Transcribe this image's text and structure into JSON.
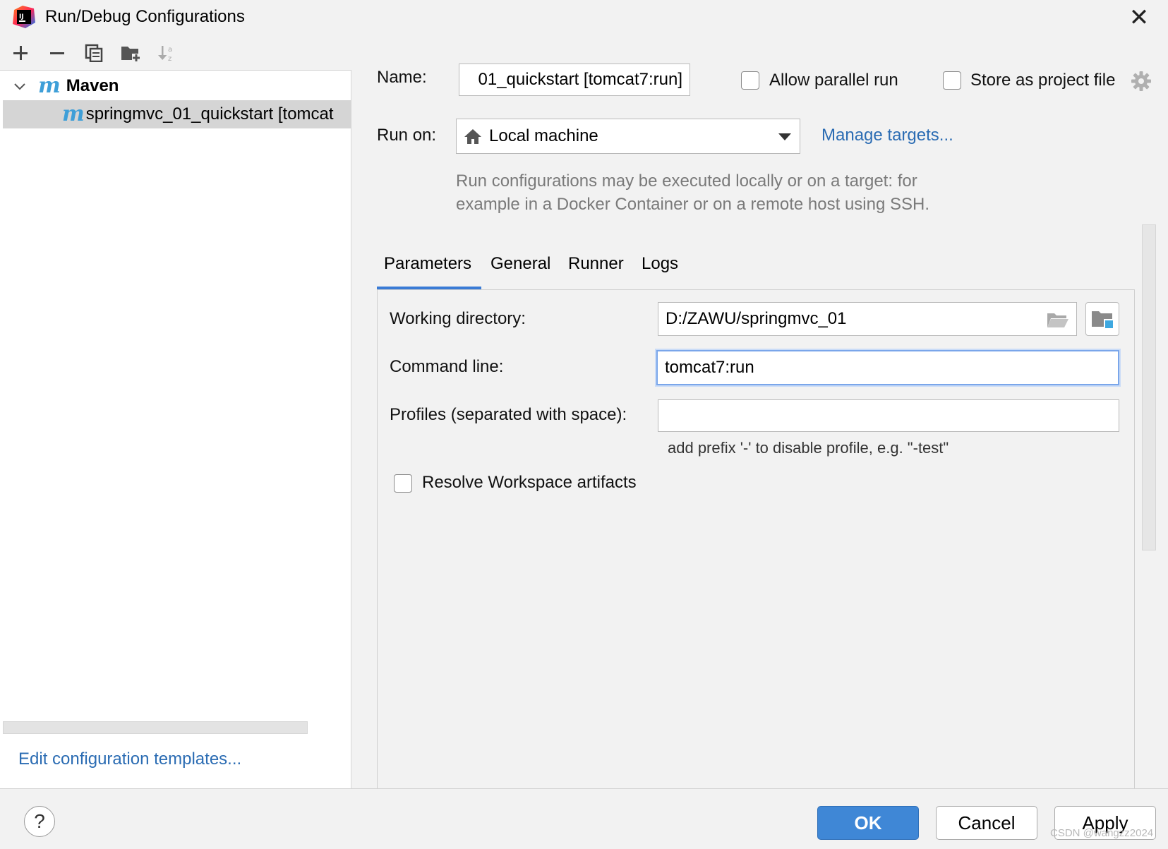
{
  "window": {
    "title": "Run/Debug Configurations",
    "close_label": "✕"
  },
  "sidebar": {
    "tree": {
      "group_label": "Maven",
      "group_icon_letter": "m",
      "item_label": "springmvc_01_quickstart [tomcat",
      "item_icon_letter": "m"
    },
    "edit_templates_link": "Edit configuration templates..."
  },
  "config": {
    "name_label": "Name:",
    "name_value": "01_quickstart [tomcat7:run]",
    "allow_parallel_label": "Allow parallel run",
    "store_project_label": "Store as project file",
    "run_on_label": "Run on:",
    "run_on_value": "Local machine",
    "manage_targets_link": "Manage targets...",
    "hint_line1": "Run configurations may be executed locally or on a target: for",
    "hint_line2": "example in a Docker Container or on a remote host using SSH."
  },
  "tabs": [
    "Parameters",
    "General",
    "Runner",
    "Logs"
  ],
  "parameters": {
    "working_dir_label": "Working directory:",
    "working_dir_value": "D:/ZAWU/springmvc_01",
    "command_line_label": "Command line:",
    "command_line_value": "tomcat7:run",
    "profiles_label": "Profiles (separated with space):",
    "profiles_value": "",
    "profiles_hint": "add prefix '-' to disable profile, e.g. \"-test\"",
    "resolve_workspace_label": "Resolve Workspace artifacts"
  },
  "buttons": {
    "help": "?",
    "ok": "OK",
    "cancel": "Cancel",
    "apply": "Apply"
  },
  "watermark": "CSDN @wangzz2024",
  "colors": {
    "accent": "#3f87d6",
    "link": "#2b6cb3",
    "maven_icon": "#3e9fd8",
    "tab_underline": "#3a7bd5"
  }
}
